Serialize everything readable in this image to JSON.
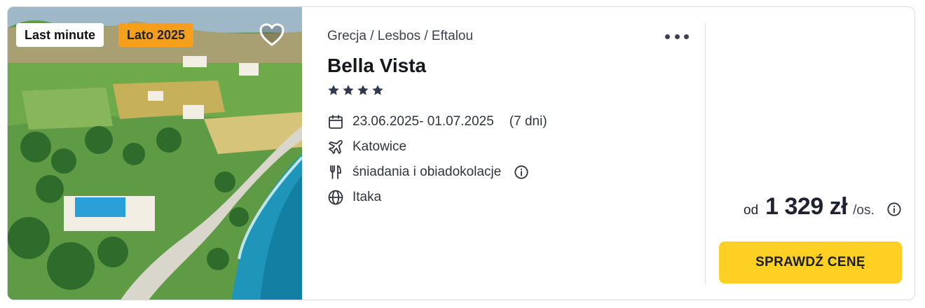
{
  "photo": {
    "alt_subject": "aerial-coast-hotel-photo",
    "badges": {
      "last_minute": "Last minute",
      "season": "Lato 2025"
    },
    "badge_colors": {
      "last_minute_bg": "#ffffff",
      "season_bg": "#f4a01c"
    }
  },
  "offer": {
    "breadcrumb": "Grecja / Lesbos / Eftalou",
    "hotel_name": "Bella Vista",
    "stars": 4,
    "dates": "23.06.2025- 01.07.2025",
    "duration": "(7 dni)",
    "departure_airport": "Katowice",
    "board": "śniadania i obiadokolacje",
    "operator": "Itaka",
    "icons": [
      "calendar-icon",
      "plane-icon",
      "cutlery-icon",
      "globe-icon"
    ]
  },
  "price": {
    "prefix": "od",
    "amount": "1 329 zł",
    "suffix": "/os."
  },
  "cta": {
    "label": "SPRAWDŹ CENĘ",
    "color": "#fdd023"
  }
}
